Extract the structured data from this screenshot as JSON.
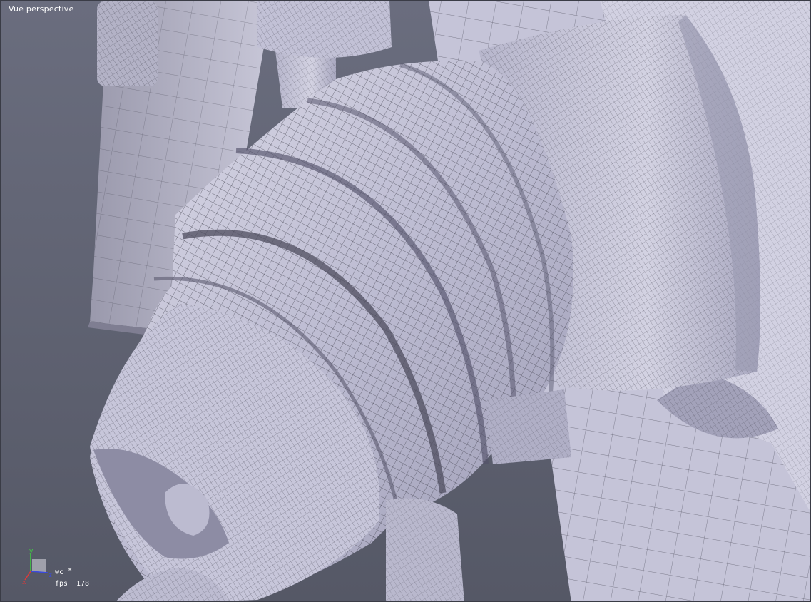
{
  "viewport": {
    "view_title": "Vue perspective",
    "background_color": "#5f6272",
    "mesh_color": "#c9c8dc",
    "wire_color": "#3c3c48"
  },
  "hud": {
    "coordinate_system": "wc",
    "modified_marker": "*",
    "fps_label": "fps",
    "fps_value": "178",
    "axes": {
      "y_label": "y",
      "x_label": "x",
      "z_label": "z",
      "y_color": "#3fd43f",
      "x_color": "#e03a3a",
      "z_color": "#3a4ae0"
    }
  }
}
